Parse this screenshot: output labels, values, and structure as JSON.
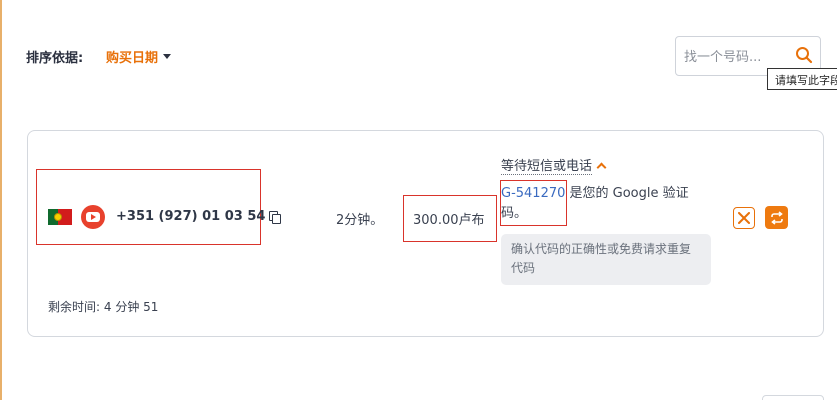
{
  "sort": {
    "label": "排序依据:",
    "value": "购买日期"
  },
  "search": {
    "placeholder": "找一个号码...",
    "tooltip": "请填写此字段"
  },
  "order": {
    "phone": "+351 (927) 01 03 54",
    "country_flag": "portugal-flag",
    "service_icon": "youtube-icon",
    "duration": "2分钟。",
    "price": "300.00卢布",
    "status": "等待短信或电话",
    "code": "G-541270",
    "message_rest": " 是您的 Google 验证码。",
    "hint": "确认代码的正确性或免费请求重复代码",
    "remaining_label": "剩余时间:",
    "remaining_value": "4 分钟 51"
  },
  "colors": {
    "accent": "#e8710a",
    "highlight_box": "#d9342b",
    "code_link": "#3a6ac0"
  }
}
